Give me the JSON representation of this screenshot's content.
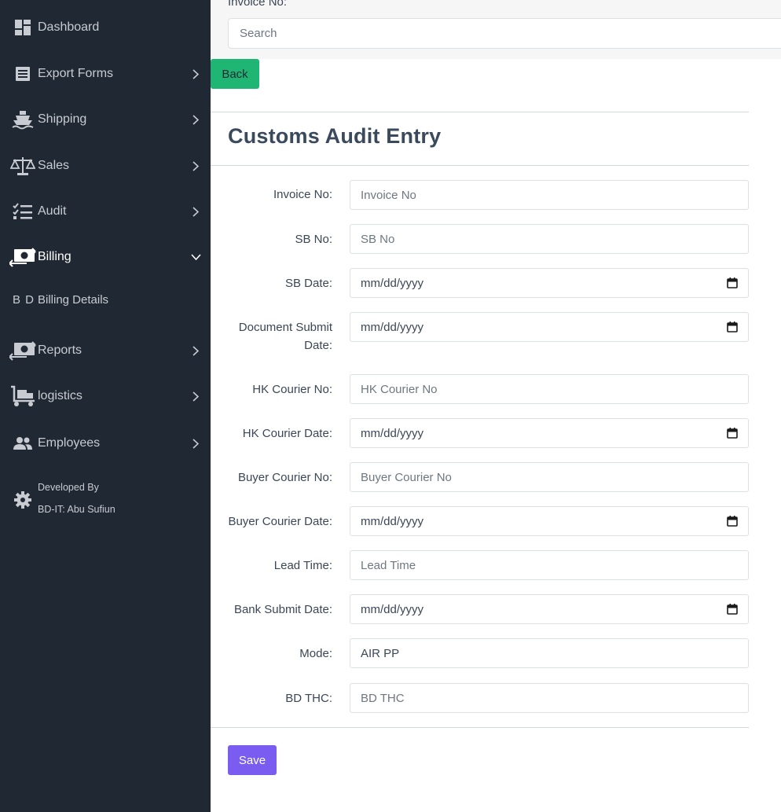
{
  "sidebar": {
    "items": [
      {
        "label": "Dashboard",
        "icon": "dashboard-icon"
      },
      {
        "label": "Export Forms",
        "icon": "list-icon"
      },
      {
        "label": "Shipping",
        "icon": "ship-icon"
      },
      {
        "label": "Sales",
        "icon": "balance-scale-icon"
      },
      {
        "label": "Audit",
        "icon": "checklist-icon"
      },
      {
        "label": "Billing",
        "icon": "money-transfer-icon"
      },
      {
        "label": "Reports",
        "icon": "money-transfer-icon"
      },
      {
        "label": "logistics",
        "icon": "dolly-icon"
      },
      {
        "label": "Employees",
        "icon": "users-icon"
      }
    ],
    "sub_item": {
      "abbr": "B D",
      "label": "Billing Details"
    },
    "developer": {
      "line1": "Developed By",
      "line2": "BD-IT: Abu Sufiun",
      "icon": "gear-icon"
    }
  },
  "top": {
    "label": "Invoice No:",
    "search_placeholder": "Search"
  },
  "back_label": "Back",
  "title": "Customs Audit Entry",
  "fields": [
    {
      "label": "Invoice No:",
      "placeholder": "Invoice No",
      "type": "text"
    },
    {
      "label": "SB No:",
      "placeholder": "SB No",
      "type": "text"
    },
    {
      "label": "SB Date:",
      "placeholder": "mm/dd/yyyy",
      "type": "date"
    },
    {
      "label_line1": "Document Submit",
      "label_line2": "Date:",
      "placeholder": "mm/dd/yyyy",
      "type": "date"
    },
    {
      "label": "HK Courier No:",
      "placeholder": "HK Courier No",
      "type": "text"
    },
    {
      "label": "HK Courier Date:",
      "placeholder": "mm/dd/yyyy",
      "type": "date"
    },
    {
      "label": "Buyer Courier No:",
      "placeholder": "Buyer Courier No",
      "type": "text"
    },
    {
      "label": "Buyer Courier Date:",
      "placeholder": "mm/dd/yyyy",
      "type": "date"
    },
    {
      "label": "Lead Time:",
      "placeholder": "Lead Time",
      "type": "text"
    },
    {
      "label": "Bank Submit Date:",
      "placeholder": "mm/dd/yyyy",
      "type": "date"
    },
    {
      "label": "Mode:",
      "value": "AIR PP",
      "type": "text"
    },
    {
      "label": "BD THC:",
      "placeholder": "BD THC",
      "type": "text"
    }
  ],
  "save_label": "Save"
}
